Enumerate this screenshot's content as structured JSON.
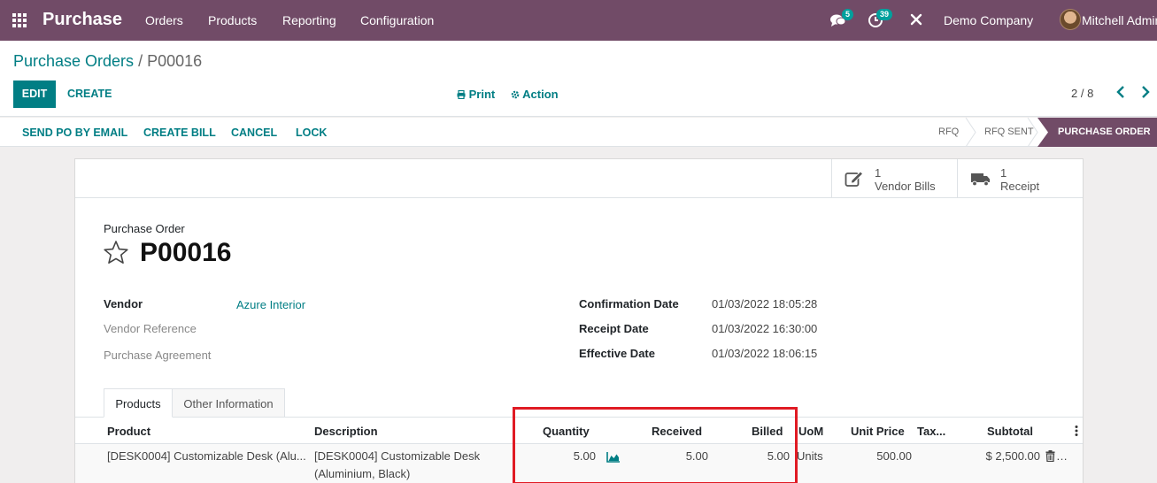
{
  "navbar": {
    "app_name": "Purchase",
    "menus": [
      "Orders",
      "Products",
      "Reporting",
      "Configuration"
    ],
    "messages_count": "5",
    "activities_count": "39",
    "company": "Demo Company",
    "user": "Mitchell Admin"
  },
  "breadcrumb": {
    "parent": "Purchase Orders",
    "separator": "/",
    "current": "P00016"
  },
  "control": {
    "edit_label": "EDIT",
    "create_label": "CREATE",
    "print_label": "Print",
    "action_label": "Action",
    "pager": "2 / 8"
  },
  "statusbar": {
    "buttons": [
      "SEND PO BY EMAIL",
      "CREATE BILL",
      "CANCEL",
      "LOCK"
    ],
    "stages": [
      "RFQ",
      "RFQ SENT",
      "PURCHASE ORDER"
    ]
  },
  "smart_buttons": [
    {
      "count": "1",
      "label": "Vendor Bills",
      "icon": "pencil-square-icon"
    },
    {
      "count": "1",
      "label": "Receipt",
      "icon": "truck-icon"
    }
  ],
  "form": {
    "title_label": "Purchase Order",
    "name": "P00016",
    "left_fields": [
      {
        "label": "Vendor",
        "value": "Azure Interior"
      },
      {
        "label": "Vendor Reference",
        "value": ""
      },
      {
        "label": "Purchase Agreement",
        "value": ""
      }
    ],
    "right_fields": [
      {
        "label": "Confirmation Date",
        "value": "01/03/2022 18:05:28"
      },
      {
        "label": "Receipt Date",
        "value": "01/03/2022 16:30:00"
      },
      {
        "label": "Effective Date",
        "value": "01/03/2022 18:06:15"
      }
    ],
    "tabs": [
      "Products",
      "Other Information"
    ]
  },
  "order_lines": {
    "columns": [
      "Product",
      "Description",
      "Quantity",
      "Received",
      "Billed",
      "UoM",
      "Unit Price",
      "Tax...",
      "Subtotal"
    ],
    "rows": [
      {
        "product": "[DESK0004] Customizable Desk (Alu...",
        "description_line1": "[DESK0004] Customizable Desk",
        "description_line2": "(Aluminium, Black)",
        "quantity": "5.00",
        "received": "5.00",
        "billed": "5.00",
        "uom": "Units",
        "unit_price": "500.00",
        "taxes": "",
        "subtotal": "$ 2,500.00"
      }
    ]
  },
  "colors": {
    "brand": "#714b67",
    "accent": "#017e84",
    "badge": "#00a09d",
    "highlight": "#e01b24"
  }
}
